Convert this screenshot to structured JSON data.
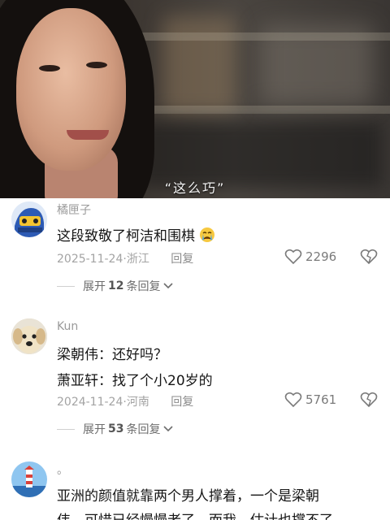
{
  "video": {
    "subtitle": "“这么巧”"
  },
  "comments": [
    {
      "username": "橘匣子",
      "lines": [
        "这段致敬了柯洁和围棋"
      ],
      "emoji_icon": "crying-face-icon",
      "date": "2025-11-24",
      "location": "浙江",
      "reply_label": "回复",
      "likes": "2296",
      "expand_prefix": "展开",
      "expand_count": "12",
      "expand_suffix": "条回复"
    },
    {
      "username": "Kun",
      "lines": [
        "梁朝伟：还好吗？",
        "萧亚轩：找了个小20岁的"
      ],
      "date": "2024-11-24",
      "location": "河南",
      "reply_label": "回复",
      "likes": "5761",
      "expand_prefix": "展开",
      "expand_count": "53",
      "expand_suffix": "条回复"
    },
    {
      "username": "。",
      "lines": [
        "亚洲的颜值就靠两个男人撑着，一个是梁朝",
        "伟，可惜已经慢慢老了，而我，估计也撑不了"
      ]
    }
  ],
  "colors": {
    "like_gray": "#7a7a7a",
    "text": "#161616",
    "meta": "#a3a3a3"
  }
}
